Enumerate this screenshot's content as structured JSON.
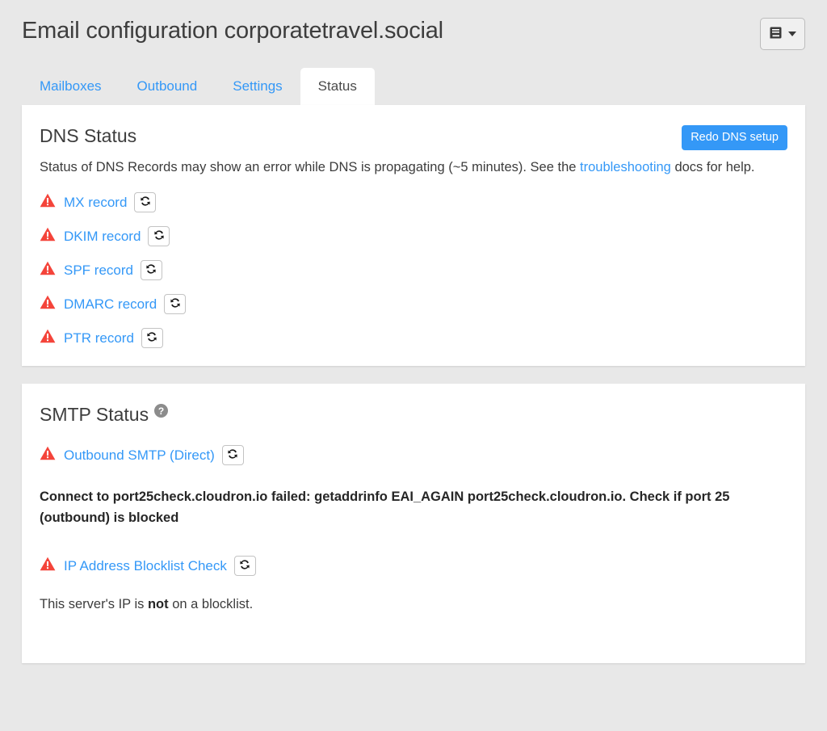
{
  "header": {
    "title": "Email configuration corporatetravel.social",
    "menu_button": {
      "icon": "book-icon",
      "caret": "chevron-down-icon"
    }
  },
  "tabs": [
    {
      "label": "Mailboxes",
      "active": false
    },
    {
      "label": "Outbound",
      "active": false
    },
    {
      "label": "Settings",
      "active": false
    },
    {
      "label": "Status",
      "active": true
    }
  ],
  "dns_card": {
    "title": "DNS Status",
    "redo_button_label": "Redo DNS setup",
    "description_before_link": "Status of DNS Records may show an error while DNS is propagating (~5 minutes). See the ",
    "description_link": "troubleshooting",
    "description_after_link": " docs for help.",
    "records": [
      {
        "label": "MX record",
        "status": "error",
        "icon": "warning-icon",
        "refresh": "refresh-icon"
      },
      {
        "label": "DKIM record",
        "status": "error",
        "icon": "warning-icon",
        "refresh": "refresh-icon"
      },
      {
        "label": "SPF record",
        "status": "error",
        "icon": "warning-icon",
        "refresh": "refresh-icon"
      },
      {
        "label": "DMARC record",
        "status": "error",
        "icon": "warning-icon",
        "refresh": "refresh-icon"
      },
      {
        "label": "PTR record",
        "status": "error",
        "icon": "warning-icon",
        "refresh": "refresh-icon"
      }
    ]
  },
  "smtp_card": {
    "title": "SMTP Status",
    "help_glyph": "?",
    "outbound": {
      "label": "Outbound SMTP (Direct)",
      "status": "error",
      "error_message": "Connect to port25check.cloudron.io failed: getaddrinfo EAI_AGAIN port25check.cloudron.io. Check if port 25 (outbound) is blocked"
    },
    "blocklist": {
      "label": "IP Address Blocklist Check",
      "status": "error",
      "note_before": "This server's IP is ",
      "note_strong": "not",
      "note_after": " on a blocklist."
    }
  },
  "colors": {
    "page_background": "#e8e8e8",
    "card_background": "#ffffff",
    "accent_blue": "#3498f7",
    "error_red": "#f4443a",
    "text_dark": "#3d3d3d",
    "help_gray": "#8c8c8c"
  }
}
